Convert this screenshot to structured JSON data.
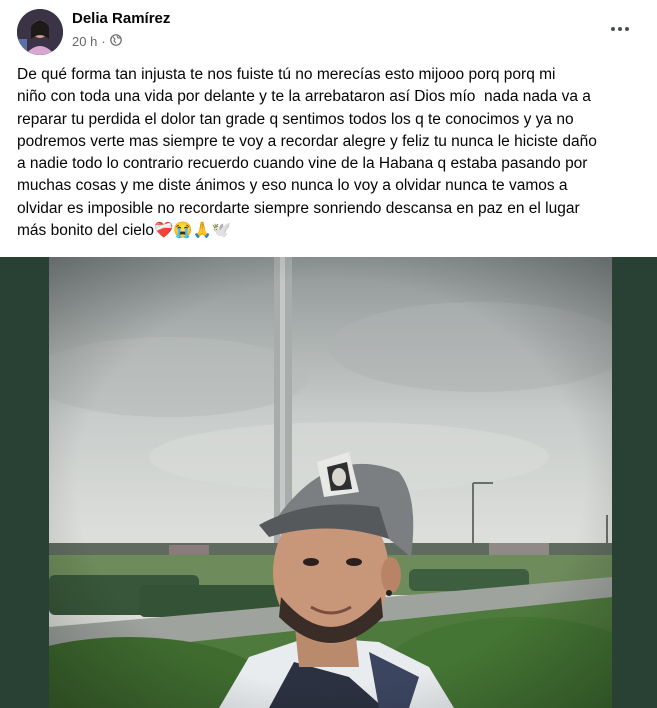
{
  "post": {
    "author": "Delia Ramírez",
    "time": "20 h",
    "meta_separator": "·",
    "privacy_icon": "globe-icon",
    "more_icon": "more-horizontal-icon",
    "text": "De qué forma tan injusta te nos fuiste tú no merecías esto mijooo porq porq mi\nniño con toda una vida por delante y te la arrebataron así Dios mío  nada nada va a\nreparar tu perdida el dolor tan grade q sentimos todos los q te conocimos y ya no\npodremos verte mas siempre te voy a recordar alegre y feliz tu nunca le hiciste daño\na nadie todo lo contrario recuerdo cuando vine de la Habana q estaba pasando por\nmuchas cosas y me diste ánimos y eso nunca lo voy a olvidar nunca te vamos a\nolvidar es imposible no recordarte siempre sonriendo descansa en paz en el lugar\nmás bonito del cielo❤️‍🩹😭🙏🕊️"
  },
  "photo": {
    "frame_color": "#294135",
    "description_icon": "photo-image"
  }
}
